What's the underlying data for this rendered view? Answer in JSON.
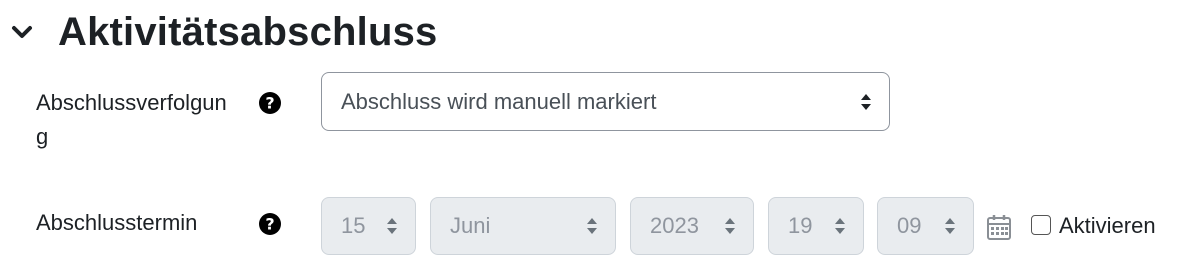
{
  "section": {
    "title": "Aktivitätsabschluss"
  },
  "completion_tracking": {
    "label_line1": "Abschlussverfolgun",
    "label_line2": "g",
    "selected": "Abschluss wird manuell markiert"
  },
  "completion_date": {
    "label": "Abschlusstermin",
    "day": "15",
    "month": "Juni",
    "year": "2023",
    "hour": "19",
    "minute": "09",
    "enable_label": "Aktivieren",
    "enabled": false
  },
  "icons": {
    "section_toggle": "chevron-down-icon",
    "help": "question-circle-icon",
    "calendar": "calendar-icon"
  }
}
